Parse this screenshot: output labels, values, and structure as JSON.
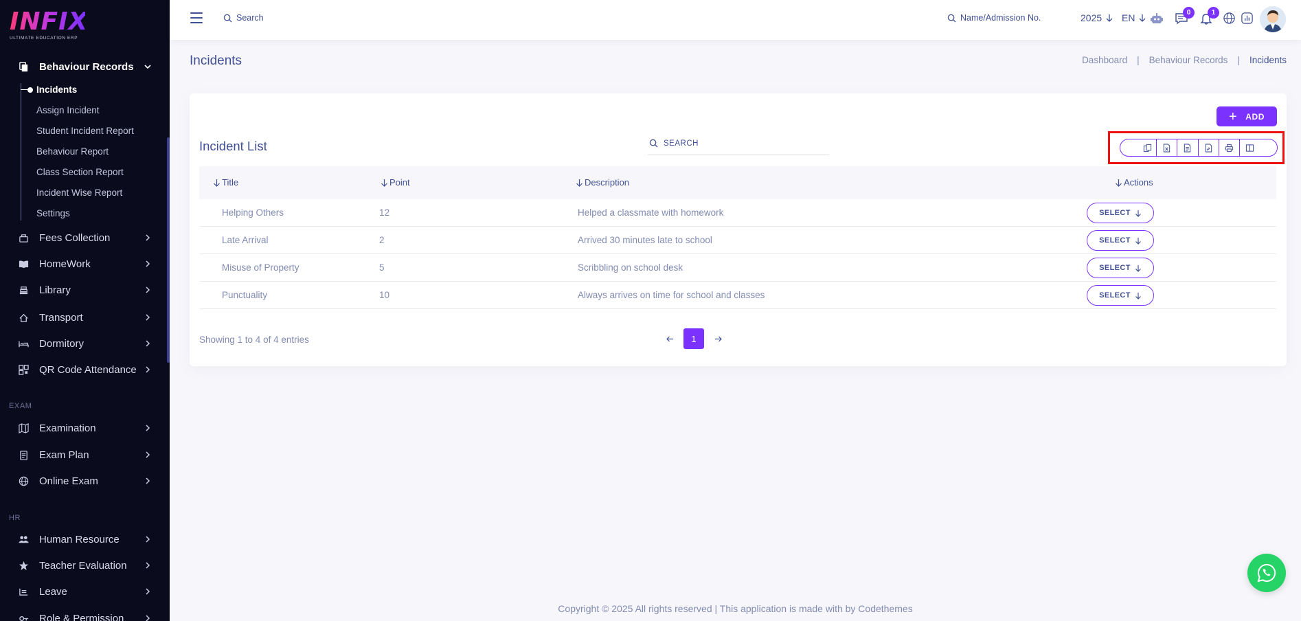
{
  "logo": {
    "main": "INFIX",
    "sub": "ULTIMATE EDUCATION ERP"
  },
  "sidebar": {
    "active_group": {
      "label": "Behaviour Records",
      "icon": "document-stack-icon"
    },
    "sub_items": [
      {
        "label": "Incidents",
        "active": true
      },
      {
        "label": "Assign Incident"
      },
      {
        "label": "Student Incident Report"
      },
      {
        "label": "Behaviour Report"
      },
      {
        "label": "Class Section Report"
      },
      {
        "label": "Incident Wise Report"
      },
      {
        "label": "Settings"
      }
    ],
    "items": [
      {
        "label": "Fees Collection",
        "icon": "fees-icon"
      },
      {
        "label": "HomeWork",
        "icon": "book-icon"
      },
      {
        "label": "Library",
        "icon": "library-icon"
      },
      {
        "label": "Transport",
        "icon": "transport-icon"
      },
      {
        "label": "Dormitory",
        "icon": "bed-icon"
      },
      {
        "label": "QR Code Attendance",
        "icon": "qr-code-icon"
      }
    ],
    "section_exam": "EXAM",
    "exam_items": [
      {
        "label": "Examination",
        "icon": "map-icon"
      },
      {
        "label": "Exam Plan",
        "icon": "clipboard-icon"
      },
      {
        "label": "Online Exam",
        "icon": "globe-icon"
      }
    ],
    "section_hr": "HR",
    "hr_items": [
      {
        "label": "Human Resource",
        "icon": "users-icon"
      },
      {
        "label": "Teacher Evaluation",
        "icon": "star-icon"
      },
      {
        "label": "Leave",
        "icon": "leave-icon"
      },
      {
        "label": "Role & Permission",
        "icon": "key-icon"
      }
    ]
  },
  "topbar": {
    "search_placeholder": "Search",
    "admission_search": "Name/Admission No.",
    "year": "2025",
    "language": "EN",
    "messages_badge": "0",
    "notifications_badge": "1"
  },
  "page": {
    "title": "Incidents",
    "breadcrumb": [
      "Dashboard",
      "Behaviour Records",
      "Incidents"
    ]
  },
  "card": {
    "add_label": "ADD",
    "list_title": "Incident List",
    "search_placeholder": "SEARCH",
    "export_buttons": [
      "copy-icon",
      "excel-icon",
      "csv-icon",
      "pdf-icon",
      "print-icon",
      "columns-icon"
    ],
    "columns": [
      "Title",
      "Point",
      "Description",
      "Actions"
    ],
    "rows": [
      {
        "title": "Helping Others",
        "point": "12",
        "description": "Helped a classmate with homework",
        "action": "SELECT"
      },
      {
        "title": "Late Arrival",
        "point": "2",
        "description": "Arrived 30 minutes late to school",
        "action": "SELECT"
      },
      {
        "title": "Misuse of Property",
        "point": "5",
        "description": "Scribbling on school desk",
        "action": "SELECT"
      },
      {
        "title": "Punctuality",
        "point": "10",
        "description": "Always arrives on time for school and classes",
        "action": "SELECT"
      }
    ],
    "showing": "Showing 1 to 4 of 4 entries",
    "current_page": "1"
  },
  "footer": "Copyright © 2025 All rights reserved | This application is made with by Codethemes",
  "colors": {
    "accent": "#7c32ff",
    "sidebar_bg": "#0b0b1e",
    "text": "#415094",
    "muted": "#828bb2",
    "highlight": "#ee1111",
    "whatsapp": "#25d366"
  }
}
